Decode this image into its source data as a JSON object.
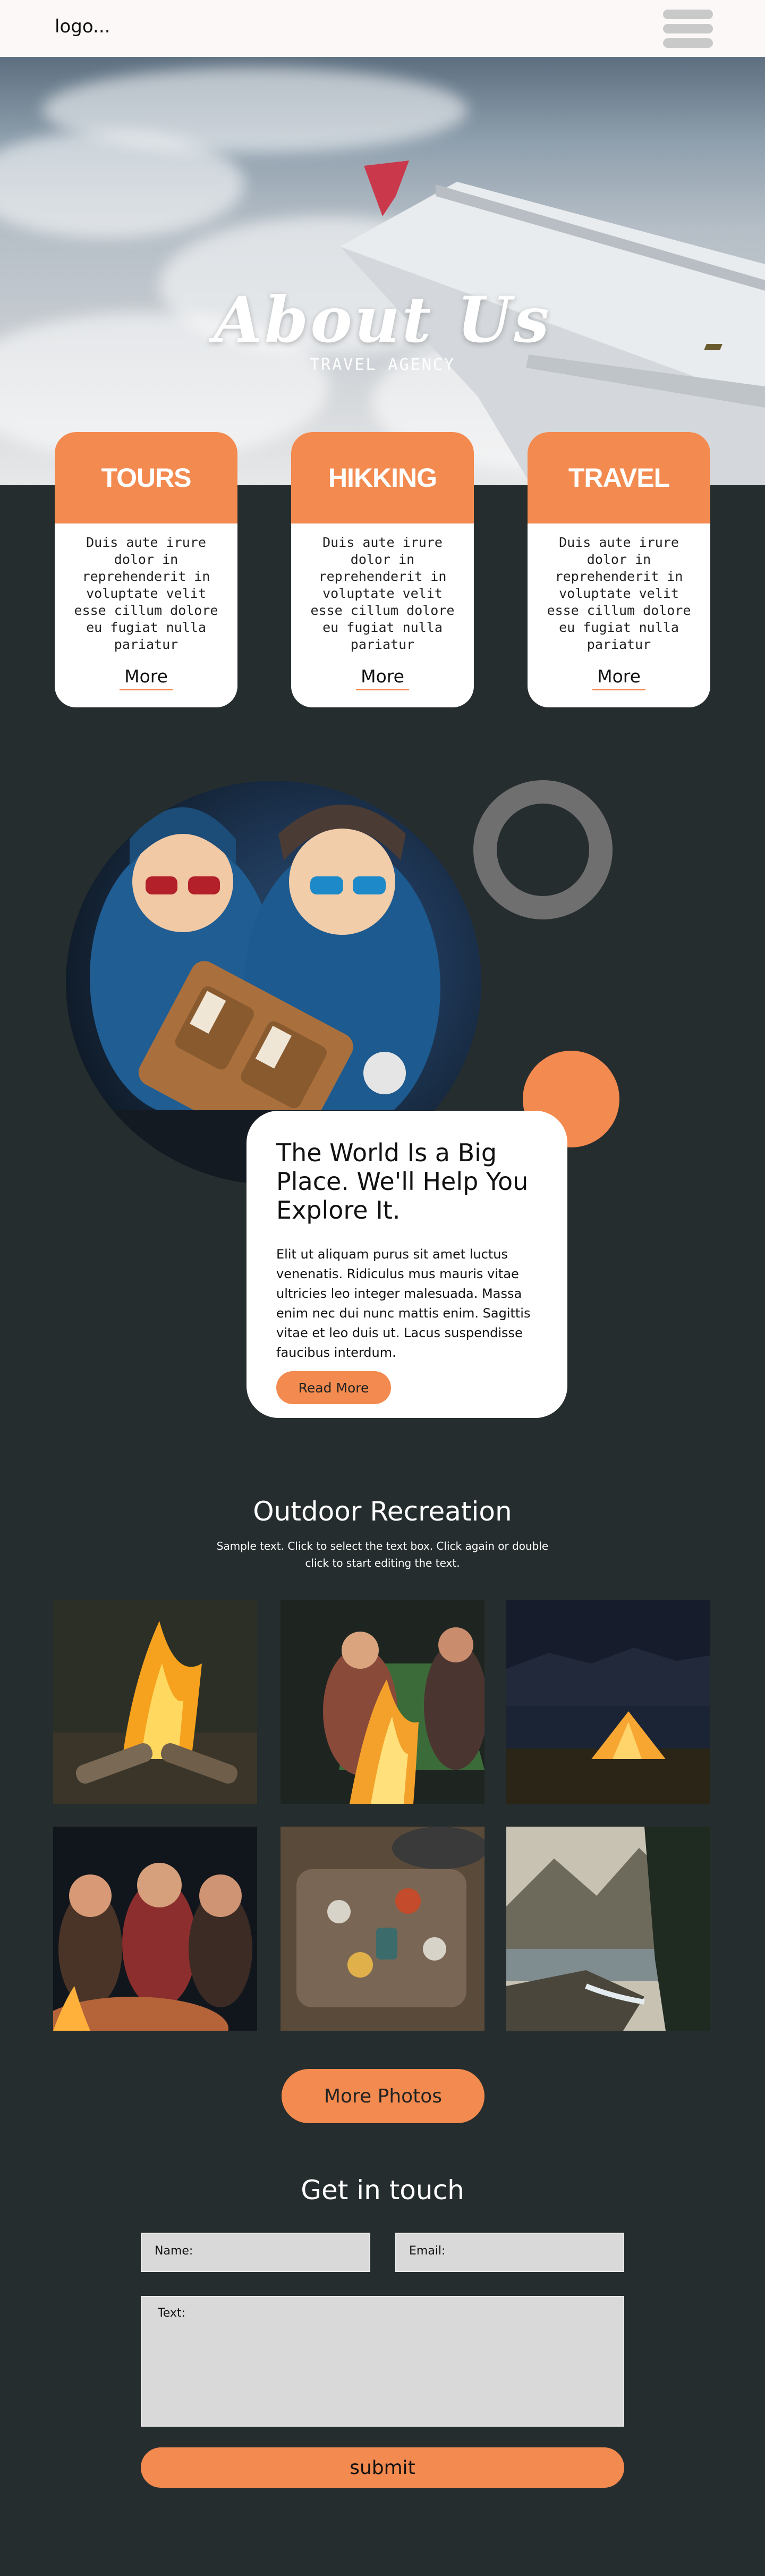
{
  "header": {
    "logo": "logo..."
  },
  "hero": {
    "title": "About Us",
    "subtitle": "TRAVEL AGENCY"
  },
  "cards": [
    {
      "title": "TOURS",
      "text": "Duis aute irure dolor in reprehenderit in voluptate velit esse cillum dolore eu fugiat nulla pariatur",
      "link": "More"
    },
    {
      "title": "HIKKING",
      "text": "Duis aute irure dolor in reprehenderit in voluptate velit esse cillum dolore eu fugiat nulla pariatur",
      "link": "More"
    },
    {
      "title": "TRAVEL",
      "text": "Duis aute irure dolor in reprehenderit in voluptate velit esse cillum dolore eu fugiat nulla pariatur",
      "link": "More"
    }
  ],
  "feature": {
    "title": "The World Is a Big Place. We'll Help You Explore It.",
    "body": "Elit ut aliquam purus sit amet luctus venenatis. Ridiculus mus mauris vitae ultricies leo integer malesuada. Massa enim nec dui nunc mattis enim. Sagittis vitae et leo duis ut. Lacus suspendisse faucibus interdum.",
    "button": "Read More"
  },
  "gallery": {
    "title": "Outdoor Recreation",
    "subtitle": "Sample text. Click to select the text box. Click again or double click to start editing the text.",
    "button": "More Photos"
  },
  "contact": {
    "title": "Get in touch",
    "name_placeholder": "Name:",
    "email_placeholder": "Email:",
    "text_placeholder": "Text:",
    "submit": "submit"
  },
  "colors": {
    "accent": "#f38a4f",
    "background": "#262d2e",
    "header": "#fcf8f7",
    "field": "#d9d9d9"
  }
}
